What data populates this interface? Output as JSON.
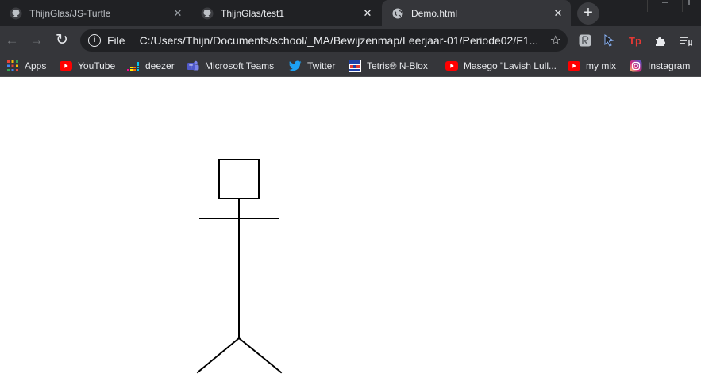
{
  "tabs": [
    {
      "title": "ThijnGlas/JS-Turtle",
      "icon": "github-icon",
      "state": "inactive"
    },
    {
      "title": "ThijnGlas/test1",
      "icon": "github-icon",
      "state": "hover"
    },
    {
      "title": "Demo.html",
      "icon": "globe-icon",
      "state": "active"
    }
  ],
  "tab_close_glyph": "✕",
  "new_tab_glyph": "+",
  "toolbar": {
    "back_glyph": "←",
    "forward_glyph": "→",
    "reload_glyph": "↻",
    "info_glyph": "i",
    "scheme": "File",
    "url": "C:/Users/Thijn/Documents/school/_MA/Bewijzenmap/Leerjaar-01/Periode02/F1...",
    "star_glyph": "☆"
  },
  "extensions": [
    "readability-icon",
    "cursor-extension-icon",
    "tp-extension-icon",
    "puzzle-extensions-icon",
    "reading-list-icon"
  ],
  "bookmarks": [
    {
      "label": "Apps",
      "icon": "apps-grid-icon"
    },
    {
      "label": "YouTube",
      "icon": "youtube-icon"
    },
    {
      "label": "deezer",
      "icon": "deezer-icon"
    },
    {
      "label": "Microsoft Teams",
      "icon": "teams-icon"
    },
    {
      "label": "Twitter",
      "icon": "twitter-icon"
    },
    {
      "label": "Tetris® N-Blox",
      "icon": "tetris-icon"
    },
    {
      "label": "Masego \"Lavish Lull...",
      "icon": "youtube-icon"
    },
    {
      "label": "my mix",
      "icon": "youtube-icon"
    },
    {
      "label": "Instagram",
      "icon": "instagram-icon"
    }
  ],
  "colors": {
    "tabstrip": "#202124",
    "toolbar": "#35363a",
    "page_background": "#ffffff",
    "drawing_stroke": "#000000"
  },
  "page": {
    "content": "turtle stick figure drawing"
  }
}
